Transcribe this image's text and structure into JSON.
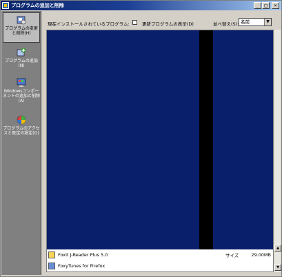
{
  "window": {
    "title": "プログラムの追加と削除"
  },
  "caption_buttons": {
    "minimize": "_",
    "maximize": "□",
    "close": "×"
  },
  "sidebar": {
    "items": [
      {
        "label": "プログラムの変更と削除(H)",
        "icon": "program-change-icon"
      },
      {
        "label": "プログラムの追加(N)",
        "icon": "program-add-icon"
      },
      {
        "label": "Windowsコンポーネントの追加と削除(A)",
        "icon": "windows-components-icon"
      },
      {
        "label": "プログラムのアクセスと既定の設定(O)",
        "icon": "access-defaults-icon"
      }
    ]
  },
  "header": {
    "installed_label": "現在インストールされているプログラム:",
    "show_updates_label": "更新プログラムの表示(D)",
    "show_updates_checked": false,
    "sort_label": "並べ替え(S):",
    "sort_value": "名前"
  },
  "programs": [
    {
      "name": "Foxit J-Reader Plus 5.0",
      "size_label": "サイズ",
      "size": "29.00MB"
    },
    {
      "name": "FoxyTunes for Firefox",
      "size_label": "",
      "size": ""
    }
  ],
  "colors": {
    "selection": "#0a1f6b",
    "titlebar": "#0a246a"
  }
}
